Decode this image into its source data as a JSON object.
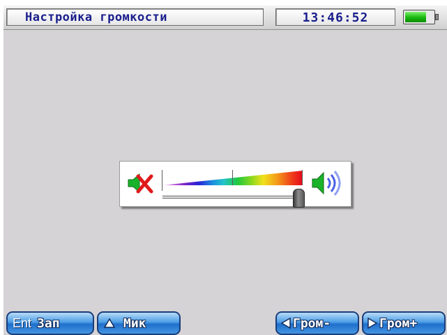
{
  "header": {
    "title": "Настройка громкости",
    "clock": "13:46:52",
    "battery_level": 0.75,
    "battery_icon": "battery-icon"
  },
  "volume": {
    "level": 0.97,
    "mute_icon": "speaker-muted-icon",
    "max_icon": "speaker-loud-icon"
  },
  "footer": {
    "buttons": [
      {
        "key": "Ent",
        "label": "Зап"
      },
      {
        "key_icon": "triangle-up-icon",
        "label": "Мик"
      },
      {
        "key_icon": "arrow-left-icon",
        "label": "Гром-"
      },
      {
        "key_icon": "arrow-right-icon",
        "label": "Гром+"
      }
    ]
  },
  "colors": {
    "screen_bg": "#d6d3d6",
    "title_text": "#1a1f8c",
    "button_blue": "#1f6fcc",
    "battery_green": "#18b70c"
  }
}
